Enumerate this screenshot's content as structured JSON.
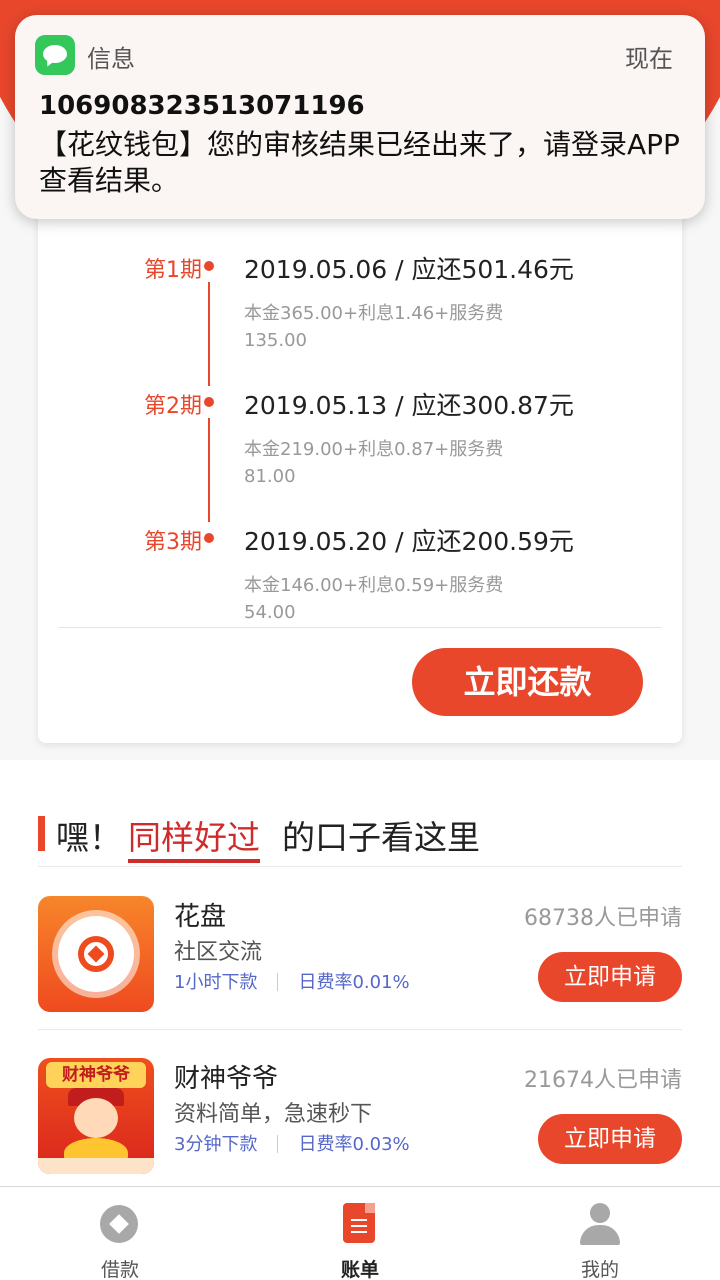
{
  "notification": {
    "app": "信息",
    "time": "现在",
    "sender": "106908323513071196",
    "body": "【花纹钱包】您的审核结果已经出来了，请登录APP查看结果。"
  },
  "schedule": {
    "periods": [
      {
        "label": "第1期",
        "main": "2019.05.06 / 应还501.46元",
        "detail": "本金365.00+利息1.46+服务费135.00"
      },
      {
        "label": "第2期",
        "main": "2019.05.13 / 应还300.87元",
        "detail": "本金219.00+利息0.87+服务费81.00"
      },
      {
        "label": "第3期",
        "main": "2019.05.20 / 应还200.59元",
        "detail": "本金146.00+利息0.59+服务费54.00"
      }
    ],
    "repay_button": "立即还款"
  },
  "section": {
    "prefix": "嘿！",
    "highlight": "同样好过",
    "suffix": "的口子看这里"
  },
  "products": [
    {
      "name": "花盘",
      "desc": "社区交流",
      "tag1": "1小时下款",
      "tag2": "日费率0.01%",
      "count": "68738人已申请",
      "button": "立即申请"
    },
    {
      "name": "财神爷爷",
      "logo_text": "财神爷爷",
      "desc": "资料简单，急速秒下",
      "tag1": "3分钟下款",
      "tag2": "日费率0.03%",
      "count": "21674人已申请",
      "button": "立即申请"
    }
  ],
  "tabbar": {
    "tabs": [
      {
        "label": "借款",
        "icon": "loan-icon"
      },
      {
        "label": "账单",
        "icon": "bill-icon",
        "active": true
      },
      {
        "label": "我的",
        "icon": "profile-icon"
      }
    ]
  },
  "colors": {
    "accent": "#e8472c",
    "highlight": "#d02b2b",
    "tag": "#5567c9",
    "notification_icon": "#34c759"
  }
}
